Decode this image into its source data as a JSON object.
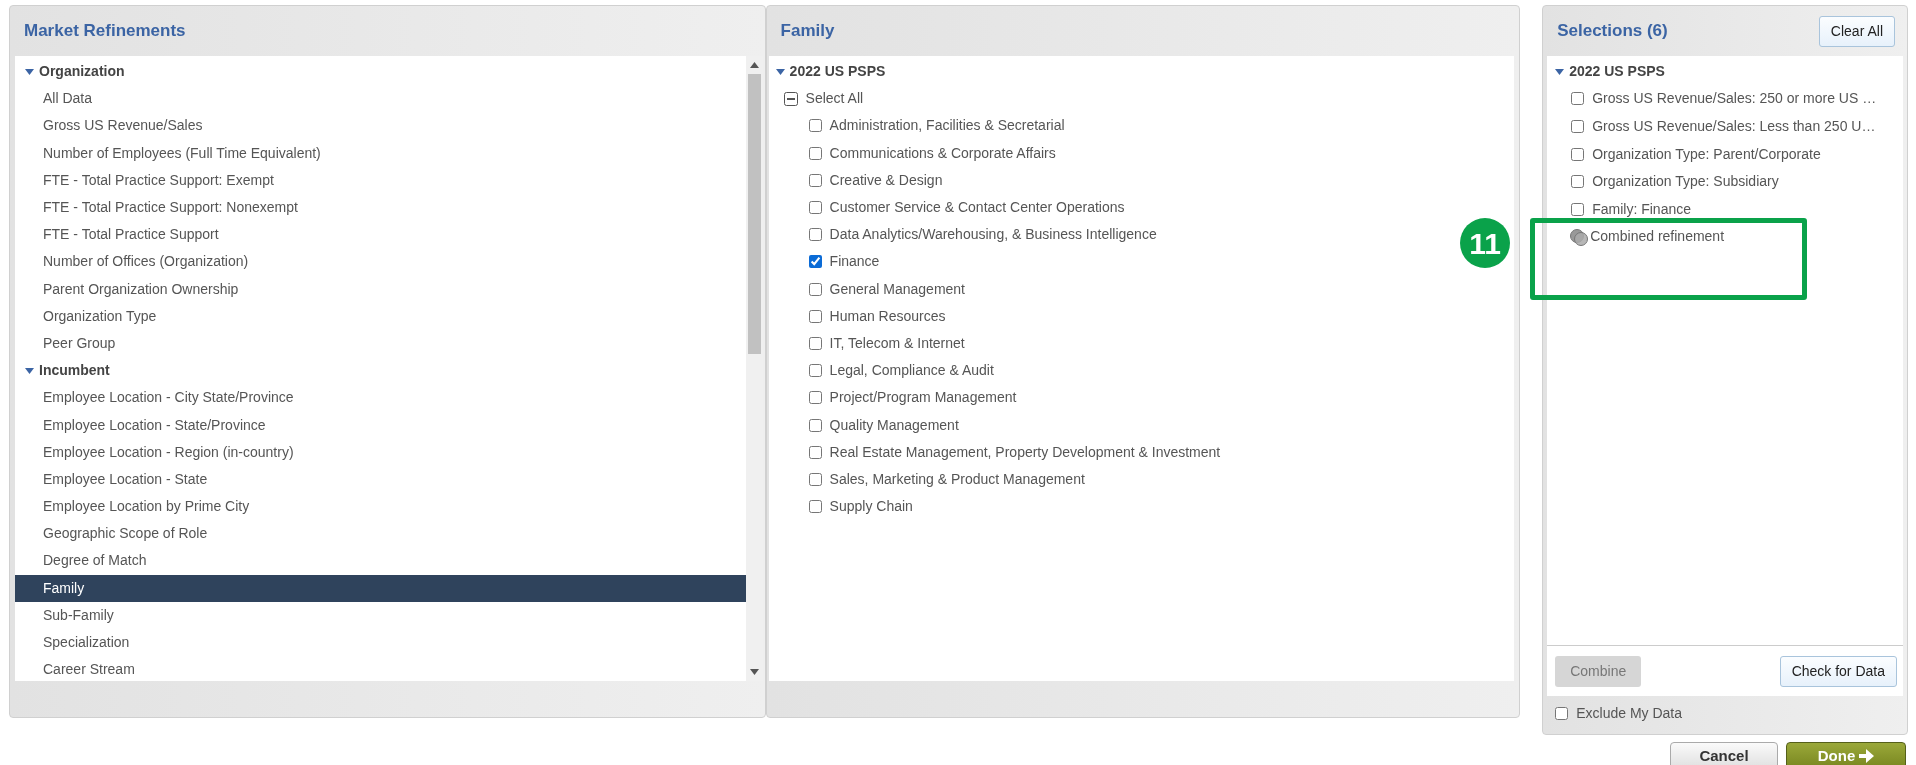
{
  "refinements_panel": {
    "title": "Market Refinements",
    "groups": [
      {
        "label": "Organization",
        "expanded": true,
        "children": [
          {
            "label": "All Data",
            "selected": false
          },
          {
            "label": "Gross US Revenue/Sales",
            "selected": false
          },
          {
            "label": "Number of Employees (Full Time Equivalent)",
            "selected": false
          },
          {
            "label": "FTE - Total Practice Support: Exempt",
            "selected": false
          },
          {
            "label": "FTE - Total Practice Support: Nonexempt",
            "selected": false
          },
          {
            "label": "FTE - Total Practice Support",
            "selected": false
          },
          {
            "label": "Number of Offices (Organization)",
            "selected": false
          },
          {
            "label": "Parent Organization Ownership",
            "selected": false
          },
          {
            "label": "Organization Type",
            "selected": false
          },
          {
            "label": "Peer Group",
            "selected": false
          }
        ]
      },
      {
        "label": "Incumbent",
        "expanded": true,
        "children": [
          {
            "label": "Employee Location - City State/Province",
            "selected": false
          },
          {
            "label": "Employee Location - State/Province",
            "selected": false
          },
          {
            "label": "Employee Location - Region (in-country)",
            "selected": false
          },
          {
            "label": "Employee Location - State",
            "selected": false
          },
          {
            "label": "Employee Location by Prime City",
            "selected": false
          },
          {
            "label": "Geographic Scope of Role",
            "selected": false
          },
          {
            "label": "Degree of Match",
            "selected": false
          },
          {
            "label": "Family",
            "selected": true
          },
          {
            "label": "Sub-Family",
            "selected": false
          },
          {
            "label": "Specialization",
            "selected": false
          },
          {
            "label": "Career Stream",
            "selected": false
          }
        ]
      }
    ]
  },
  "family_panel": {
    "title": "Family",
    "survey": {
      "label": "2022 US PSPS",
      "expanded": true
    },
    "select_all": {
      "label": "Select All",
      "indeterminate": true
    },
    "options": [
      {
        "label": "Administration, Facilities & Secretarial",
        "checked": false
      },
      {
        "label": "Communications & Corporate Affairs",
        "checked": false
      },
      {
        "label": "Creative & Design",
        "checked": false
      },
      {
        "label": "Customer Service & Contact Center Operations",
        "checked": false
      },
      {
        "label": "Data Analytics/Warehousing, & Business Intelligence",
        "checked": false
      },
      {
        "label": "Finance",
        "checked": true
      },
      {
        "label": "General Management",
        "checked": false
      },
      {
        "label": "Human Resources",
        "checked": false
      },
      {
        "label": "IT, Telecom & Internet",
        "checked": false
      },
      {
        "label": "Legal, Compliance & Audit",
        "checked": false
      },
      {
        "label": "Project/Program Management",
        "checked": false
      },
      {
        "label": "Quality Management",
        "checked": false
      },
      {
        "label": "Real Estate Management, Property Development & Investment",
        "checked": false
      },
      {
        "label": "Sales, Marketing & Product Management",
        "checked": false
      },
      {
        "label": "Supply Chain",
        "checked": false
      }
    ]
  },
  "selections_panel": {
    "title": "Selections (6)",
    "clear_button": "Clear All",
    "survey": {
      "label": "2022 US PSPS",
      "expanded": true
    },
    "items": [
      {
        "kind": "checkbox",
        "label": "Gross US Revenue/Sales: 250 or more US …",
        "checked": false
      },
      {
        "kind": "checkbox",
        "label": "Gross US Revenue/Sales: Less than 250 U…",
        "checked": false
      },
      {
        "kind": "checkbox",
        "label": "Organization Type: Parent/Corporate",
        "checked": false
      },
      {
        "kind": "checkbox",
        "label": "Organization Type: Subsidiary",
        "checked": false
      },
      {
        "kind": "checkbox",
        "label": "Family: Finance",
        "checked": false
      },
      {
        "kind": "combined",
        "label": "Combined refinement"
      }
    ],
    "combine_button": {
      "label": "Combine",
      "disabled": true
    },
    "check_button": "Check for Data",
    "exclude": {
      "label": "Exclude My Data",
      "checked": false
    }
  },
  "footer_buttons": [
    {
      "kind": "cancel",
      "label": "Cancel"
    },
    {
      "kind": "done",
      "label": "Done"
    }
  ],
  "annotation": {
    "label": "11"
  }
}
